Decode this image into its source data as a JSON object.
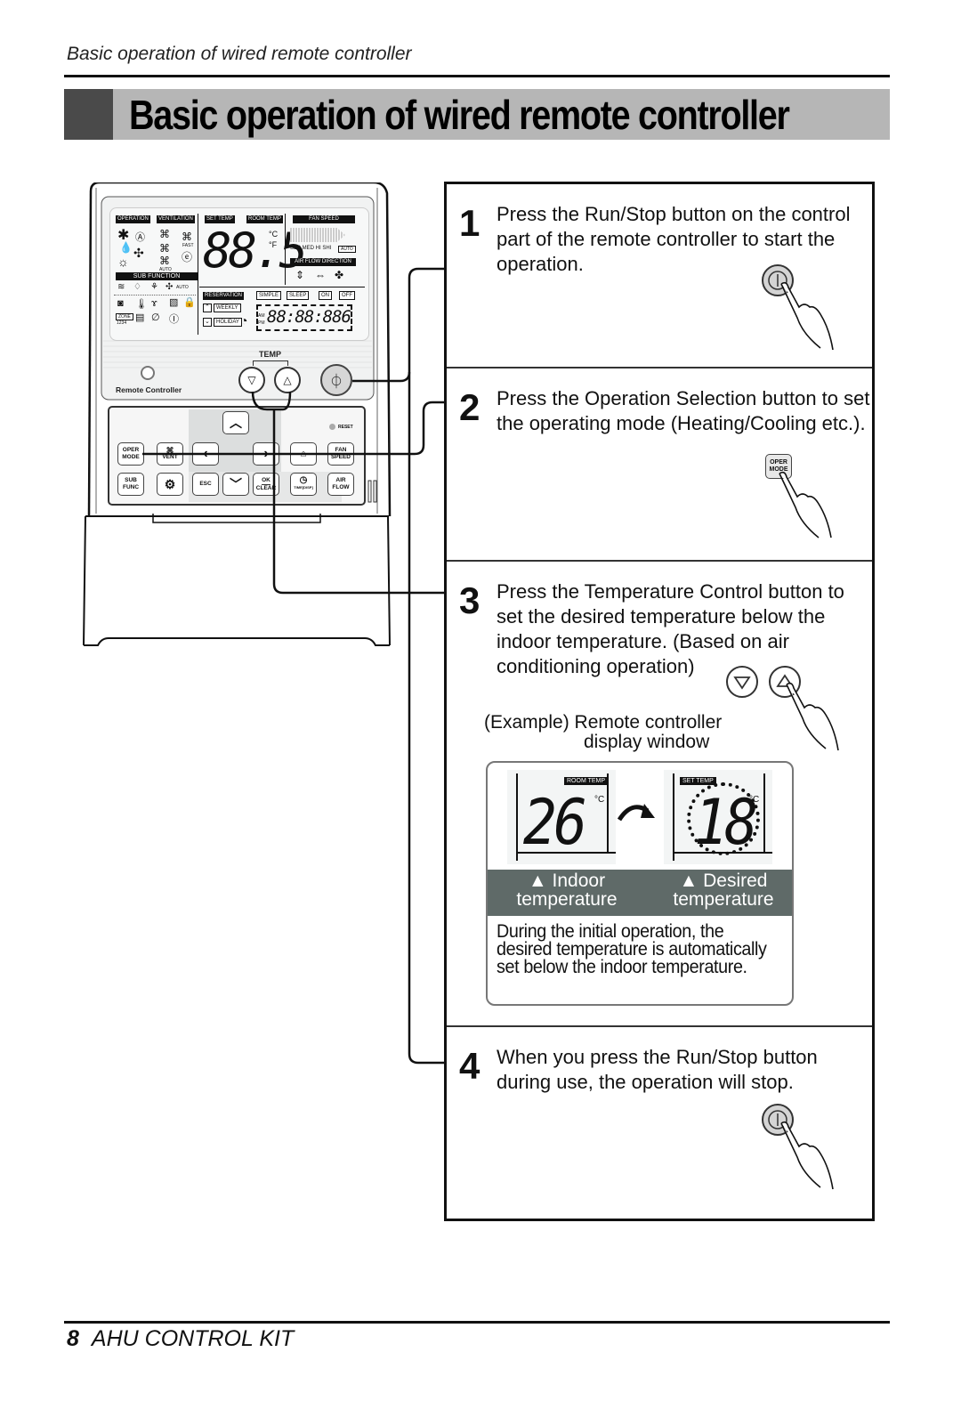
{
  "header": {
    "running_head": "Basic operation of wired remote controller",
    "title": "Basic operation of wired remote controller"
  },
  "colors": {
    "title_bar": "#b6b6b6",
    "title_block": "#4a4a4a",
    "caption_band": "#5f6a68",
    "rule": "#111111"
  },
  "remote": {
    "lcd": {
      "tags": [
        "OPERATION",
        "VENTILATION",
        "SET TEMP",
        "ROOM TEMP",
        "FAN SPEED",
        "SUB FUNCTION",
        "AIR FLOW DIRECTION",
        "RESERVATION"
      ],
      "fan_levels": "SLO MED HI SHI",
      "fan_auto": "AUTO",
      "vent_fast": "FAST",
      "vent_auto": "AUTO",
      "main_digits": "88.5",
      "unit_c": "°C",
      "unit_f": "°F",
      "reservation_options": [
        "SIMPLE",
        "SLEEP",
        "ON",
        "OFF"
      ],
      "weekly": "WEEKLY",
      "holiday": "HOLIDAY",
      "am": "AM",
      "pm": "PM",
      "timer_digits": "88:88:886",
      "zone": "ZONE",
      "zone_numbers": "1234"
    },
    "temp_label": "TEMP",
    "brand_label": "Remote Controller",
    "reset_label": "RESET",
    "keys": {
      "oper_mode": [
        "OPER",
        "MODE"
      ],
      "vent": "VENT",
      "fan_speed": [
        "FAN",
        "SPEED"
      ],
      "sub_func": [
        "SUB",
        "FUNC"
      ],
      "esc": "ESC",
      "ok_clear": [
        "OK",
        "CLEAR"
      ],
      "time_disp": "TIME[DISP]",
      "air_flow": [
        "AIR",
        "FLOW"
      ]
    }
  },
  "steps": [
    {
      "number": "1",
      "text": "Press the Run/Stop button on the control part of the remote controller to start the operation.",
      "illustration": "run-stop-button-press"
    },
    {
      "number": "2",
      "text": "Press the Operation Selection button to set the operating mode (Heating/Cooling etc.).",
      "illustration": "oper-mode-button-press",
      "button_label": [
        "OPER",
        "MODE"
      ]
    },
    {
      "number": "3",
      "text": "Press the Temperature Control button to set the desired temperature below the indoor temperature. (Based on air conditioning operation)",
      "illustration": "temp-up-button-press",
      "example": {
        "caption_line1": "(Example) Remote controller",
        "caption_line2": "display window",
        "room_badge": "ROOM TEMP",
        "room_value": "26",
        "set_badge": "SET TEMP",
        "set_value": "18",
        "unit": "°C",
        "indoor_label": [
          "▲ Indoor",
          "temperature"
        ],
        "desired_label": [
          "▲ Desired",
          "temperature"
        ],
        "note": "During the initial operation, the desired temperature is automatically set below the indoor temperature."
      }
    },
    {
      "number": "4",
      "text": "When you press the Run/Stop button during use, the operation will stop.",
      "illustration": "run-stop-button-press"
    }
  ],
  "footer": {
    "page_number": "8",
    "title": "AHU CONTROL KIT"
  }
}
